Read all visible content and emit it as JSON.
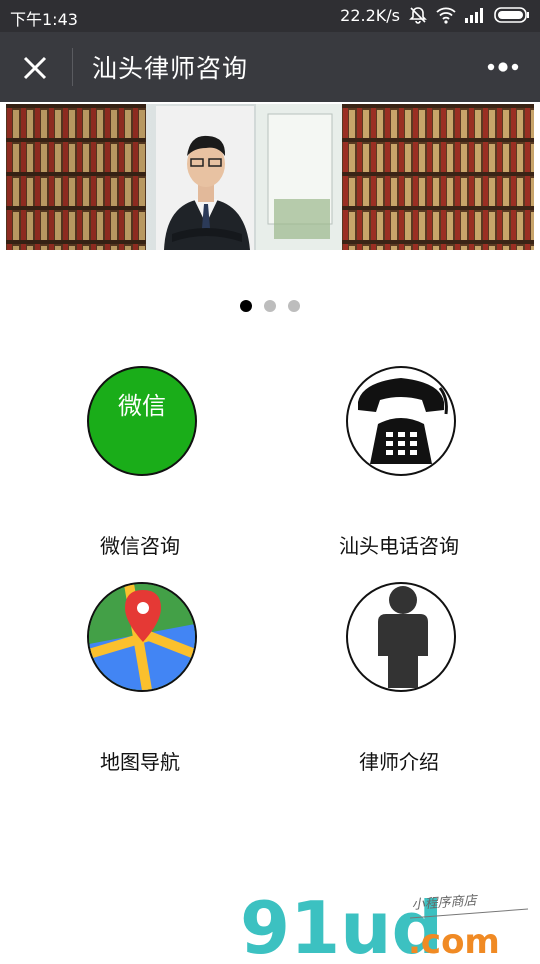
{
  "status_bar": {
    "time": "下午1:43",
    "network_speed": "22.2K/s",
    "icons": [
      "mute-bell-icon",
      "wifi-icon",
      "signal-icon",
      "battery-icon"
    ]
  },
  "nav": {
    "title": "汕头律师咨询",
    "close_icon": "close-icon",
    "more_icon": "more-icon"
  },
  "carousel": {
    "total_slides": 3,
    "active_index": 0
  },
  "menu": [
    {
      "label": "微信咨询",
      "icon_text": "微信",
      "icon": "wechat-icon",
      "color": "#1aad19"
    },
    {
      "label": "汕头电话咨询",
      "icon": "telephone-icon",
      "color": "#111111"
    },
    {
      "label": "地图导航",
      "icon": "map-pin-icon",
      "color": "#e53935"
    },
    {
      "label": "律师介绍",
      "icon": "person-icon",
      "color": "#333333"
    }
  ],
  "watermark": {
    "brand": "91ud",
    "domain": ".com",
    "tagline": "小程序商店"
  }
}
